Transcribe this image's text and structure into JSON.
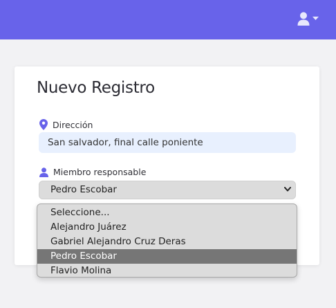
{
  "header": {
    "user_icon": "user-icon",
    "caret_icon": "caret-down-icon",
    "brand_color": "#6863ea"
  },
  "form": {
    "title": "Nuevo Registro",
    "direccion": {
      "label": "Dirección",
      "icon": "map-marker-icon",
      "value": "San salvador, final calle poniente"
    },
    "miembro": {
      "label": "Miembro responsable",
      "icon": "user-icon",
      "selected": "Pedro Escobar",
      "options": [
        "Seleccione...",
        "Alejandro Juárez",
        "Gabriel Alejandro Cruz Deras",
        "Pedro Escobar",
        "Flavio Molina"
      ],
      "highlighted_index": 3
    }
  }
}
